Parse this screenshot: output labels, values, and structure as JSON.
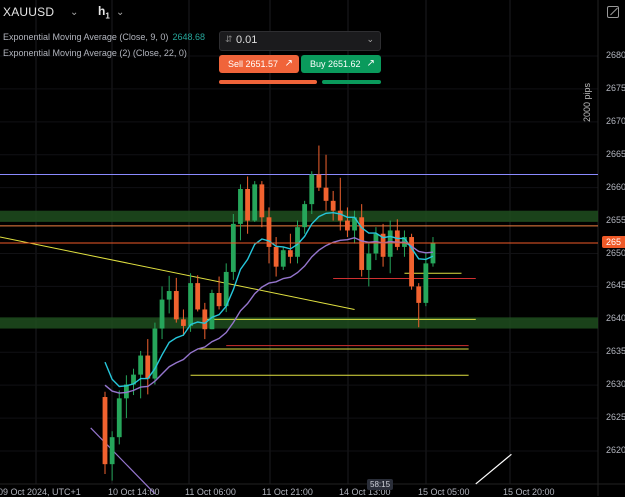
{
  "symbol": "XAUUSD",
  "timeframe": "h",
  "timeframe_sub": "1",
  "indicators": [
    {
      "label": "Exponential Moving Average (Close, 9, 0)",
      "value": "2648.68",
      "color": "#26c6da"
    },
    {
      "label": "Exponential Moving Average (2) (Close, 22, 0)",
      "value": "",
      "color": "#9575cd"
    }
  ],
  "trade_panel": {
    "lot_size": "0.01",
    "sell_label": "Sell 2651.57",
    "buy_label": "Buy 2651.62",
    "sell_color": "#f0643a",
    "buy_color": "#0a9a5c"
  },
  "ruler_label": "2000 pips",
  "price_axis": {
    "ticks": [
      "2680",
      "2675",
      "2670",
      "2665",
      "2660",
      "2655",
      "2650",
      "2645",
      "2640",
      "2635",
      "2630",
      "2625",
      "2620"
    ],
    "last_price_label": "265",
    "last_price_color": "#ef5a28"
  },
  "time_axis": {
    "ticks": [
      "09 Oct 2024, UTC+1",
      "10 Oct 14:00",
      "11 Oct 06:00",
      "11 Oct 21:00",
      "14 Oct 13:00",
      "15 Oct 05:00",
      "15 Oct 20:00"
    ],
    "countdown": "58:15"
  },
  "chart_data": {
    "type": "candlestick",
    "y_range": [
      2615,
      2684
    ],
    "last_price": 2651.6,
    "colors": {
      "up": "#26a65b",
      "down": "#f1622f",
      "ema9": "#26c6da",
      "ema22": "#9575cd"
    },
    "candles": [
      [
        2628.2,
        2629.0,
        2616.5,
        2618.0
      ],
      [
        2618.0,
        2623.0,
        2615.5,
        2622.1
      ],
      [
        2622.1,
        2629.2,
        2621.0,
        2628.0
      ],
      [
        2628.0,
        2631.5,
        2625.0,
        2630.1
      ],
      [
        2630.1,
        2632.5,
        2628.5,
        2631.6
      ],
      [
        2631.6,
        2635.2,
        2628.0,
        2634.5
      ],
      [
        2634.5,
        2637.0,
        2628.6,
        2631.0
      ],
      [
        2631.0,
        2639.5,
        2630.1,
        2638.6
      ],
      [
        2638.6,
        2645.0,
        2637.0,
        2643.0
      ],
      [
        2643.0,
        2646.6,
        2640.9,
        2644.3
      ],
      [
        2644.3,
        2646.3,
        2639.5,
        2640.0
      ],
      [
        2640.0,
        2641.5,
        2637.5,
        2639.0
      ],
      [
        2639.0,
        2647.0,
        2638.1,
        2645.5
      ],
      [
        2645.5,
        2646.7,
        2641.2,
        2641.5
      ],
      [
        2641.5,
        2642.5,
        2637.0,
        2638.5
      ],
      [
        2638.5,
        2644.5,
        2638.5,
        2644.0
      ],
      [
        2644.0,
        2646.5,
        2641.5,
        2642.0
      ],
      [
        2642.0,
        2648.5,
        2641.1,
        2647.2
      ],
      [
        2647.2,
        2656.0,
        2646.0,
        2654.5
      ],
      [
        2654.5,
        2660.5,
        2652.0,
        2659.8
      ],
      [
        2659.8,
        2661.7,
        2653.0,
        2655.0
      ],
      [
        2655.0,
        2661.0,
        2654.8,
        2660.5
      ],
      [
        2660.5,
        2661.0,
        2654.0,
        2655.5
      ],
      [
        2655.5,
        2657.0,
        2648.5,
        2651.0
      ],
      [
        2651.0,
        2652.5,
        2646.5,
        2648.0
      ],
      [
        2648.0,
        2651.0,
        2647.5,
        2650.5
      ],
      [
        2650.5,
        2653.0,
        2648.5,
        2649.5
      ],
      [
        2649.5,
        2655.0,
        2648.5,
        2654.0
      ],
      [
        2654.0,
        2658.0,
        2653.0,
        2657.5
      ],
      [
        2657.5,
        2662.5,
        2656.0,
        2662.0
      ],
      [
        2662.0,
        2666.4,
        2659.5,
        2660.0
      ],
      [
        2660.0,
        2665.0,
        2656.5,
        2658.0
      ],
      [
        2658.0,
        2659.5,
        2655.0,
        2656.5
      ],
      [
        2656.5,
        2661.5,
        2653.5,
        2655.0
      ],
      [
        2655.0,
        2657.0,
        2652.5,
        2653.5
      ],
      [
        2653.5,
        2656.5,
        2651.5,
        2655.5
      ],
      [
        2655.5,
        2657.5,
        2646.5,
        2647.5
      ],
      [
        2647.5,
        2651.5,
        2645.0,
        2650.0
      ],
      [
        2650.0,
        2654.0,
        2649.0,
        2653.0
      ],
      [
        2653.0,
        2654.5,
        2648.0,
        2649.5
      ],
      [
        2649.5,
        2655.0,
        2647.0,
        2653.5
      ],
      [
        2653.5,
        2655.2,
        2650.5,
        2651.0
      ],
      [
        2651.0,
        2653.5,
        2649.5,
        2652.5
      ],
      [
        2652.5,
        2653.0,
        2644.5,
        2645.0
      ],
      [
        2645.0,
        2645.5,
        2638.8,
        2642.5
      ],
      [
        2642.5,
        2650.0,
        2642.0,
        2648.5
      ],
      [
        2648.5,
        2652.5,
        2648.0,
        2651.6
      ]
    ],
    "ema9": [
      2633.5,
      2630.9,
      2629.8,
      2629.9,
      2630.2,
      2631.0,
      2631.0,
      2632.5,
      2634.6,
      2636.5,
      2637.2,
      2637.6,
      2639.2,
      2639.6,
      2639.4,
      2640.3,
      2640.7,
      2642.0,
      2644.5,
      2647.6,
      2649.1,
      2651.4,
      2652.2,
      2651.9,
      2651.1,
      2651.0,
      2650.7,
      2651.4,
      2652.6,
      2654.5,
      2655.6,
      2656.1,
      2656.2,
      2656.0,
      2655.5,
      2655.5,
      2653.9,
      2653.1,
      2653.1,
      2652.4,
      2652.6,
      2652.3,
      2652.3,
      2650.8,
      2649.2,
      2649.1,
      2649.6
    ],
    "ema22": [
      2630.0,
      2629.1,
      2628.8,
      2628.9,
      2629.2,
      2629.7,
      2629.8,
      2630.6,
      2631.7,
      2632.8,
      2633.4,
      2633.9,
      2634.9,
      2635.5,
      2635.8,
      2636.6,
      2637.1,
      2638.0,
      2639.5,
      2641.3,
      2642.4,
      2643.9,
      2644.9,
      2645.5,
      2645.7,
      2646.2,
      2646.4,
      2647.1,
      2648.1,
      2649.5,
      2650.5,
      2651.2,
      2651.7,
      2652.0,
      2652.1,
      2652.4,
      2651.9,
      2651.7,
      2651.8,
      2651.6,
      2651.8,
      2651.7,
      2651.7,
      2651.1,
      2650.3,
      2650.1,
      2650.2
    ],
    "zones": [
      {
        "y_top": 2656.5,
        "y_bottom": 2654.8,
        "color": "#1e4d1e"
      },
      {
        "y_top": 2640.3,
        "y_bottom": 2638.6,
        "color": "#1e4d1e"
      }
    ],
    "levels": [
      {
        "price": 2662.0,
        "color": "#8a8aff",
        "x_start_idx": 0,
        "x_end_idx": 60
      },
      {
        "price": 2654.2,
        "color": "#f08040",
        "x_start_idx": 0,
        "x_end_idx": 60
      },
      {
        "price": 2647.0,
        "color": "#e0e040",
        "x_start_idx": 42,
        "x_end_idx": 50
      },
      {
        "price": 2646.2,
        "color": "#d03030",
        "x_start_idx": 32,
        "x_end_idx": 52
      },
      {
        "price": 2640.0,
        "color": "#e0e040",
        "x_start_idx": 14,
        "x_end_idx": 52
      },
      {
        "price": 2636.0,
        "color": "#d03030",
        "x_start_idx": 17,
        "x_end_idx": 51
      },
      {
        "price": 2635.5,
        "color": "#e0e040",
        "x_start_idx": 13,
        "x_end_idx": 51
      },
      {
        "price": 2631.5,
        "color": "#e0e040",
        "x_start_idx": 12,
        "x_end_idx": 51
      }
    ],
    "trendline": {
      "color": "#e0e040",
      "from": [
        0,
        2652.5
      ],
      "to": [
        35,
        2641.5
      ]
    },
    "extra_lines": [
      {
        "color": "#9575cd",
        "from": [
          -2,
          2623.5
        ],
        "to": [
          7,
          2613.5
        ]
      },
      {
        "color": "#ffffff",
        "from": [
          52,
          2615.0
        ],
        "to": [
          57,
          2619.5
        ]
      }
    ]
  }
}
